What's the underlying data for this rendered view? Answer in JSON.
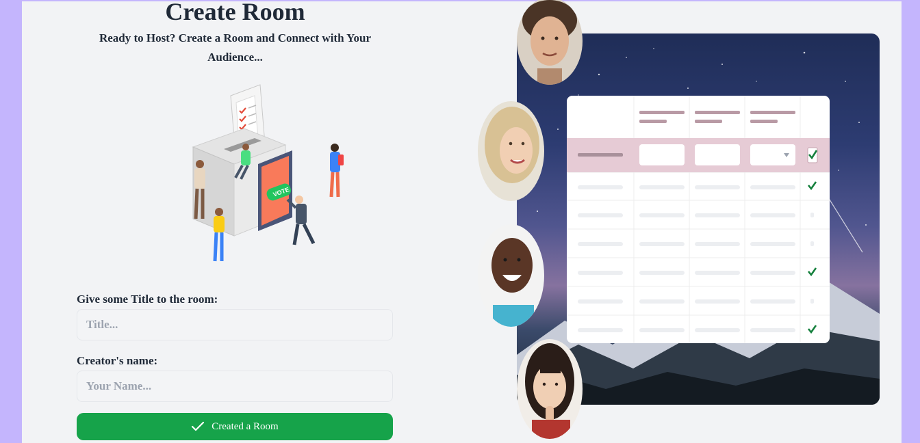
{
  "header": {
    "title": "Create Room",
    "subtitle": "Ready to Host? Create a Room and Connect with Your Audience..."
  },
  "form": {
    "title_label": "Give some Title to the room:",
    "title_placeholder": "Title...",
    "title_value": "",
    "name_label": "Creator's name:",
    "name_placeholder": "Your Name...",
    "name_value": "",
    "submit_label": "Created a Room"
  },
  "illustration": {
    "vote_sign": "VOTE"
  },
  "colors": {
    "accent": "#16a34a",
    "page_background": "#c4b5fd",
    "panel_background": "#f2f3f5",
    "highlight_row": "#e6cbd5",
    "check": "#15803d"
  },
  "icons": {
    "submit": "check-icon",
    "table_check": "checkmark-icon",
    "dropdown": "triangle-down-icon"
  }
}
